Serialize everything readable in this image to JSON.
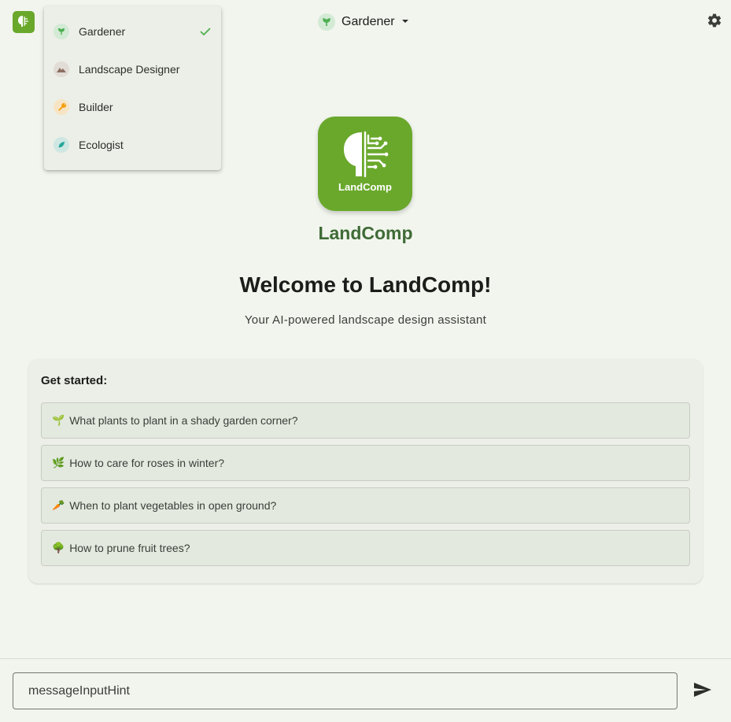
{
  "header": {
    "app_icon": "landcomp-logo-icon",
    "selected_role": "Gardener",
    "settings_icon": "gear-icon"
  },
  "role_menu": {
    "items": [
      {
        "label": "Gardener",
        "icon": "sprout-icon",
        "icon_color": "#4caf50",
        "icon_bg": "#d3ead5",
        "selected": true
      },
      {
        "label": "Landscape Designer",
        "icon": "landscape-icon",
        "icon_color": "#8d6e63",
        "icon_bg": "#e2dcd6",
        "selected": false
      },
      {
        "label": "Builder",
        "icon": "wrench-icon",
        "icon_color": "#f59e0b",
        "icon_bg": "#f6e4c4",
        "selected": false
      },
      {
        "label": "Ecologist",
        "icon": "leaf-icon",
        "icon_color": "#26a69a",
        "icon_bg": "#cfe7e3",
        "selected": false
      }
    ]
  },
  "brand": {
    "logo_text": "LandComp",
    "name": "LandComp"
  },
  "welcome": {
    "title": "Welcome to LandComp!",
    "subtitle": "Your AI-powered landscape design assistant"
  },
  "get_started": {
    "title": "Get started:",
    "suggestions": [
      {
        "emoji": "🌱",
        "text": "What plants to plant in a shady garden corner?"
      },
      {
        "emoji": "🌿",
        "text": "How to care for roses in winter?"
      },
      {
        "emoji": "🥕",
        "text": "When to plant vegetables in open ground?"
      },
      {
        "emoji": "🌳",
        "text": "How to prune fruit trees?"
      }
    ]
  },
  "composer": {
    "placeholder": "messageInputHint",
    "send_icon": "send-icon"
  },
  "colors": {
    "background": "#f2f5ee",
    "brand_green": "#6aa82c",
    "brand_text": "#3f6b36",
    "check": "#4caf50"
  }
}
